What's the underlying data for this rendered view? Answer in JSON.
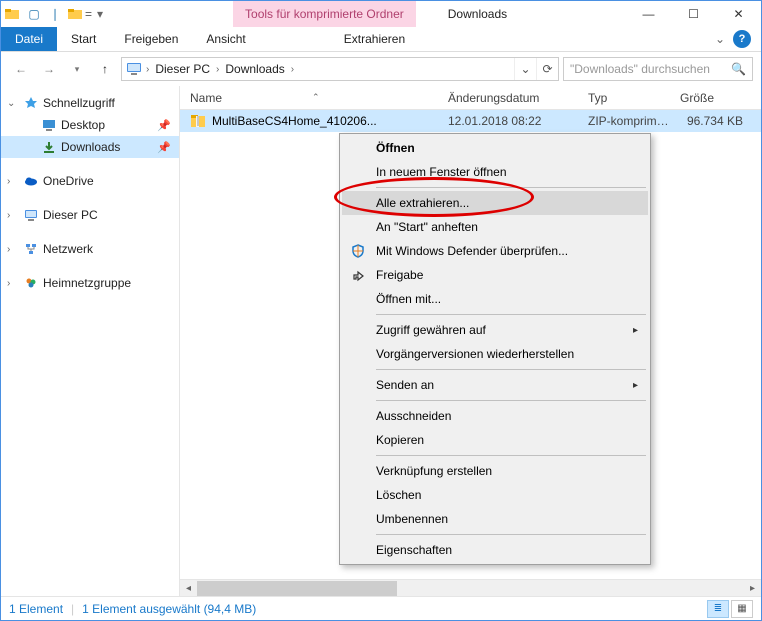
{
  "titlebar": {
    "tool_tab": "Tools für komprimierte Ordner",
    "window_title": "Downloads"
  },
  "ribbon": {
    "file": "Datei",
    "tabs": [
      "Start",
      "Freigeben",
      "Ansicht"
    ],
    "extract": "Extrahieren"
  },
  "breadcrumb": {
    "root": "Dieser PC",
    "folder": "Downloads"
  },
  "search": {
    "placeholder": "\"Downloads\" durchsuchen"
  },
  "sidebar": {
    "quick": "Schnellzugriff",
    "desktop": "Desktop",
    "downloads": "Downloads",
    "onedrive": "OneDrive",
    "thispc": "Dieser PC",
    "network": "Netzwerk",
    "homegroup": "Heimnetzgruppe"
  },
  "columns": {
    "name": "Name",
    "date": "Änderungsdatum",
    "type": "Typ",
    "size": "Größe"
  },
  "file": {
    "name": "MultiBaseCS4Home_410206...",
    "date": "12.01.2018 08:22",
    "type": "ZIP-komprimierter...",
    "size": "96.734 KB"
  },
  "context": {
    "open": "Öffnen",
    "open_new": "In neuem Fenster öffnen",
    "extract_all": "Alle extrahieren...",
    "pin_start": "An \"Start\" anheften",
    "defender": "Mit Windows Defender überprüfen...",
    "share": "Freigabe",
    "open_with": "Öffnen mit...",
    "grant_access": "Zugriff gewähren auf",
    "prev_versions": "Vorgängerversionen wiederherstellen",
    "send_to": "Senden an",
    "cut": "Ausschneiden",
    "copy": "Kopieren",
    "shortcut": "Verknüpfung erstellen",
    "delete": "Löschen",
    "rename": "Umbenennen",
    "properties": "Eigenschaften"
  },
  "status": {
    "count": "1 Element",
    "selection": "1 Element ausgewählt (94,4 MB)"
  }
}
